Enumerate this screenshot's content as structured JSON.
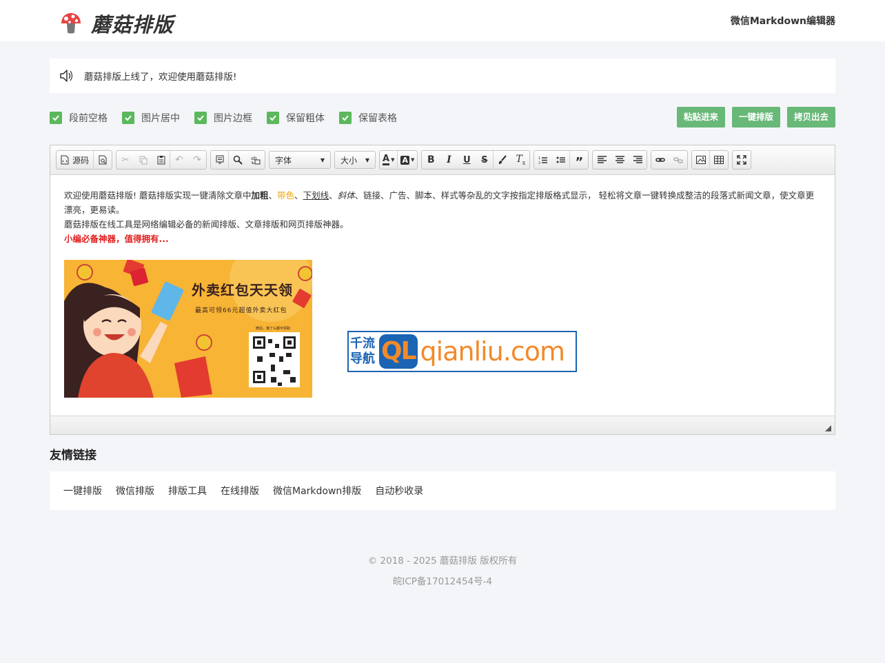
{
  "header": {
    "logo_text": "蘑菇排版",
    "nav_link": "微信Markdown编辑器"
  },
  "notice": {
    "text": "蘑菇排版上线了，欢迎使用蘑菇排版!"
  },
  "options": [
    {
      "label": "段前空格",
      "checked": true
    },
    {
      "label": "图片居中",
      "checked": true
    },
    {
      "label": "图片边框",
      "checked": true
    },
    {
      "label": "保留粗体",
      "checked": true
    },
    {
      "label": "保留表格",
      "checked": true
    }
  ],
  "actions": {
    "paste": "粘贴进来",
    "format": "一键排版",
    "copy": "拷贝出去"
  },
  "toolbar": {
    "source": "源码",
    "font": "字体",
    "size": "大小"
  },
  "content": {
    "p1_a": "欢迎使用蘑菇排版!  蘑菇排版实现一键清除文章中",
    "p1_bold": "加粗",
    "p1_b": "、",
    "p1_color": "带色",
    "p1_c": "、",
    "p1_under": "下划线",
    "p1_d": "、",
    "p1_italic": "斜体",
    "p1_e": "、链接、广告、脚本、样式等杂乱的文字按指定排版格式显示，  轻松将文章一键转换成整洁的段落式新闻文章，使文章更漂亮，更易读。",
    "p2": "蘑菇排版在线工具是网络编辑必备的新闻排版、文章排版和网页排版神器。",
    "p3": "小编必备神器，值得拥有..."
  },
  "promo_image": {
    "title": "外卖红包天天领",
    "subtitle": "最高可领66元超值外卖大红包",
    "qr_hint": "微信，饿了么都可领取"
  },
  "ql_image": {
    "cn1": "千流",
    "cn2": "导航",
    "badge": "QL",
    "domain": "qianliu.com"
  },
  "friends": {
    "title": "友情链接",
    "links": [
      "一键排版",
      "微信排版",
      "排版工具",
      "在线排版",
      "微信Markdown排版",
      "自动秒收录"
    ]
  },
  "footer": {
    "copyright": "© 2018 - 2025 蘑菇排版 版权所有",
    "icp": "皖ICP备17012454号-4"
  },
  "colors": {
    "accent_green": "#68b878",
    "checkbox_green": "#5cb85c",
    "highlight_orange": "#f0a500",
    "highlight_red": "#e02020",
    "page_bg": "#f4f5f8"
  }
}
